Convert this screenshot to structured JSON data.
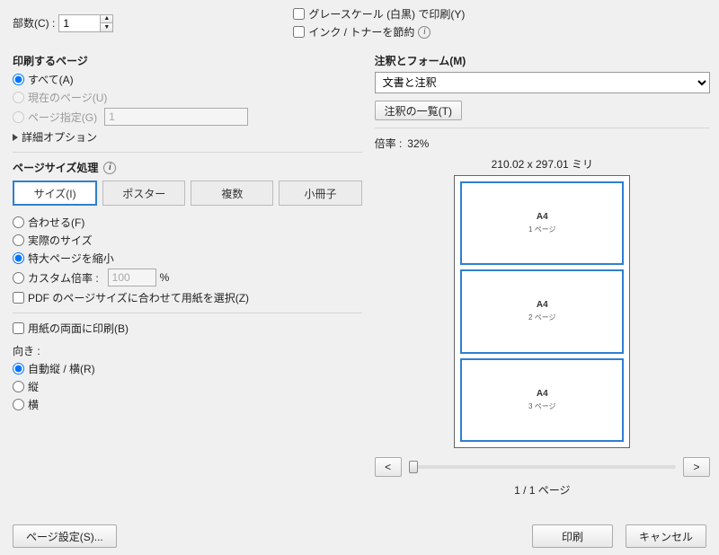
{
  "top": {
    "copies_label": "部数(C) :",
    "copies_value": "1",
    "grayscale": "グレースケール (白黒) で印刷(Y)",
    "save_ink": "インク / トナーを節約"
  },
  "range": {
    "title": "印刷するページ",
    "all": "すべて(A)",
    "current": "現在のページ(U)",
    "pages": "ページ指定(G)",
    "pages_value": "1",
    "advanced": "詳細オプション"
  },
  "size": {
    "title": "ページサイズ処理",
    "tab_size": "サイズ(I)",
    "tab_poster": "ポスター",
    "tab_multi": "複数",
    "tab_booklet": "小冊子",
    "fit": "合わせる(F)",
    "actual": "実際のサイズ",
    "shrink": "特大ページを縮小",
    "custom": "カスタム倍率 :",
    "custom_value": "100",
    "pct": "%",
    "choose_paper": "PDF のページサイズに合わせて用紙を選択(Z)"
  },
  "duplex": "用紙の両面に印刷(B)",
  "orient": {
    "title": "向き :",
    "auto": "自動縦 / 横(R)",
    "portrait": "縦",
    "landscape": "横"
  },
  "forms": {
    "title": "注釈とフォーム(M)",
    "selected": "文書と注釈",
    "summary_btn": "注釈の一覧(T)"
  },
  "preview": {
    "scale_label": "倍率 :",
    "scale_value": "32%",
    "dims": "210.02 x 297.01 ミリ",
    "page_label_A4": "A4",
    "p1": "1 ページ",
    "p2": "2 ページ",
    "p3": "3 ページ",
    "prev": "<",
    "next": ">",
    "page_counter": "1 / 1 ページ"
  },
  "footer": {
    "page_setup": "ページ設定(S)...",
    "print": "印刷",
    "cancel": "キャンセル"
  }
}
